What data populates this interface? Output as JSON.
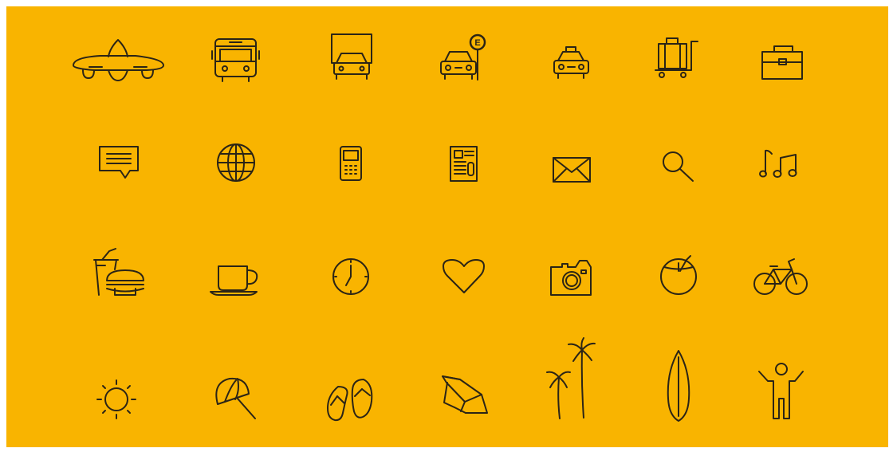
{
  "background_color": "#F9B400",
  "icon_color": "#2b2416",
  "rows": [
    [
      "airplane-icon",
      "bus-icon",
      "truck-icon",
      "car-parking-sign-icon",
      "taxi-icon",
      "luggage-trolley-icon",
      "briefcase-icon"
    ],
    [
      "chat-message-icon",
      "globe-icon",
      "mobile-phone-icon",
      "newspaper-icon",
      "envelope-icon",
      "magnifier-icon",
      "music-notes-icon"
    ],
    [
      "fast-food-icon",
      "coffee-cup-icon",
      "clock-icon",
      "heart-icon",
      "camera-icon",
      "coconut-drink-icon",
      "bicycle-icon"
    ],
    [
      "sun-icon",
      "beach-umbrella-icon",
      "flip-flops-icon",
      "deck-chair-icon",
      "palm-trees-icon",
      "surfboard-icon",
      "person-icon"
    ]
  ],
  "parking_sign_letter": "E"
}
